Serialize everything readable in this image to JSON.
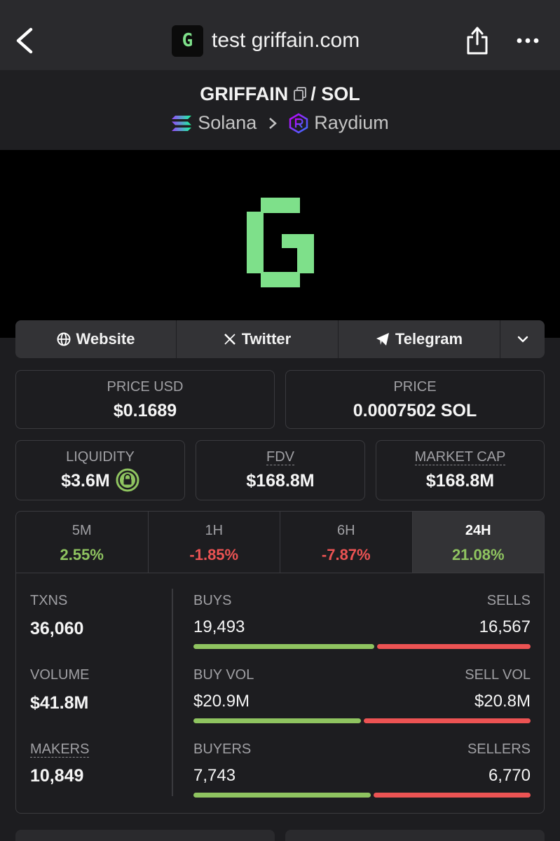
{
  "browser": {
    "site_title": "test griffain.com",
    "favicon_letter": "G"
  },
  "pair": {
    "base": "GRIFFAIN",
    "separator": "/",
    "quote": "SOL",
    "chain": "Solana",
    "dex": "Raydium"
  },
  "links": [
    {
      "label": "Website",
      "icon": "globe-icon"
    },
    {
      "label": "Twitter",
      "icon": "x-icon"
    },
    {
      "label": "Telegram",
      "icon": "telegram-icon"
    }
  ],
  "prices": {
    "usd_label": "PRICE USD",
    "usd_value": "$0.1689",
    "native_label": "PRICE",
    "native_value": "0.0007502 SOL"
  },
  "metrics": {
    "liquidity_label": "LIQUIDITY",
    "liquidity_value": "$3.6M",
    "fdv_label": "FDV",
    "fdv_value": "$168.8M",
    "mcap_label": "MARKET CAP",
    "mcap_value": "$168.8M"
  },
  "timeframes": [
    {
      "label": "5M",
      "change": "2.55%",
      "direction": "up"
    },
    {
      "label": "1H",
      "change": "-1.85%",
      "direction": "down"
    },
    {
      "label": "6H",
      "change": "-7.87%",
      "direction": "down"
    },
    {
      "label": "24H",
      "change": "21.08%",
      "direction": "up",
      "active": true
    }
  ],
  "activity": {
    "txns_label": "TXNS",
    "txns_value": "36,060",
    "volume_label": "VOLUME",
    "volume_value": "$41.8M",
    "makers_label": "MAKERS",
    "makers_value": "10,849",
    "buys_label": "BUYS",
    "buys_value": "19,493",
    "sells_label": "SELLS",
    "sells_value": "16,567",
    "buys_ratio": 0.54,
    "buyvol_label": "BUY VOL",
    "buyvol_value": "$20.9M",
    "sellvol_label": "SELL VOL",
    "sellvol_value": "$20.8M",
    "buyvol_ratio": 0.5,
    "buyers_label": "BUYERS",
    "buyers_value": "7,743",
    "sellers_label": "SELLERS",
    "sellers_value": "6,770",
    "buyers_ratio": 0.53
  },
  "colors": {
    "positive": "#8fc460",
    "negative": "#ec5353",
    "brand_green": "#7ee08a",
    "background": "#1d1d20"
  }
}
